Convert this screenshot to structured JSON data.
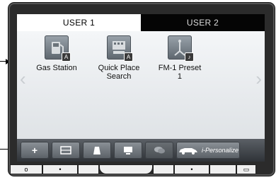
{
  "tabs": [
    {
      "label": "USER 1",
      "active": true
    },
    {
      "label": "USER 2",
      "active": false
    }
  ],
  "shortcuts": [
    {
      "line1": "Gas Station",
      "line2": "",
      "icon": "gas-station-icon",
      "badge": "A"
    },
    {
      "line1": "Quick Place",
      "line2": "Search",
      "icon": "quick-place-search-icon",
      "badge": "A"
    },
    {
      "line1": "FM-1 Preset",
      "line2": "1",
      "icon": "fm-radio-icon",
      "badge": "♪"
    }
  ],
  "toolbar": {
    "add_label": "+",
    "personalize_label": "i-Personalize"
  },
  "hardware_buttons": [
    "o",
    "•",
    "•",
    "▭"
  ],
  "colors": {
    "tab_active_bg": "#ffffff",
    "tab_inactive_bg": "#050505",
    "content_bg": "#eef0f2",
    "toolbar_bg": "#45494e"
  }
}
